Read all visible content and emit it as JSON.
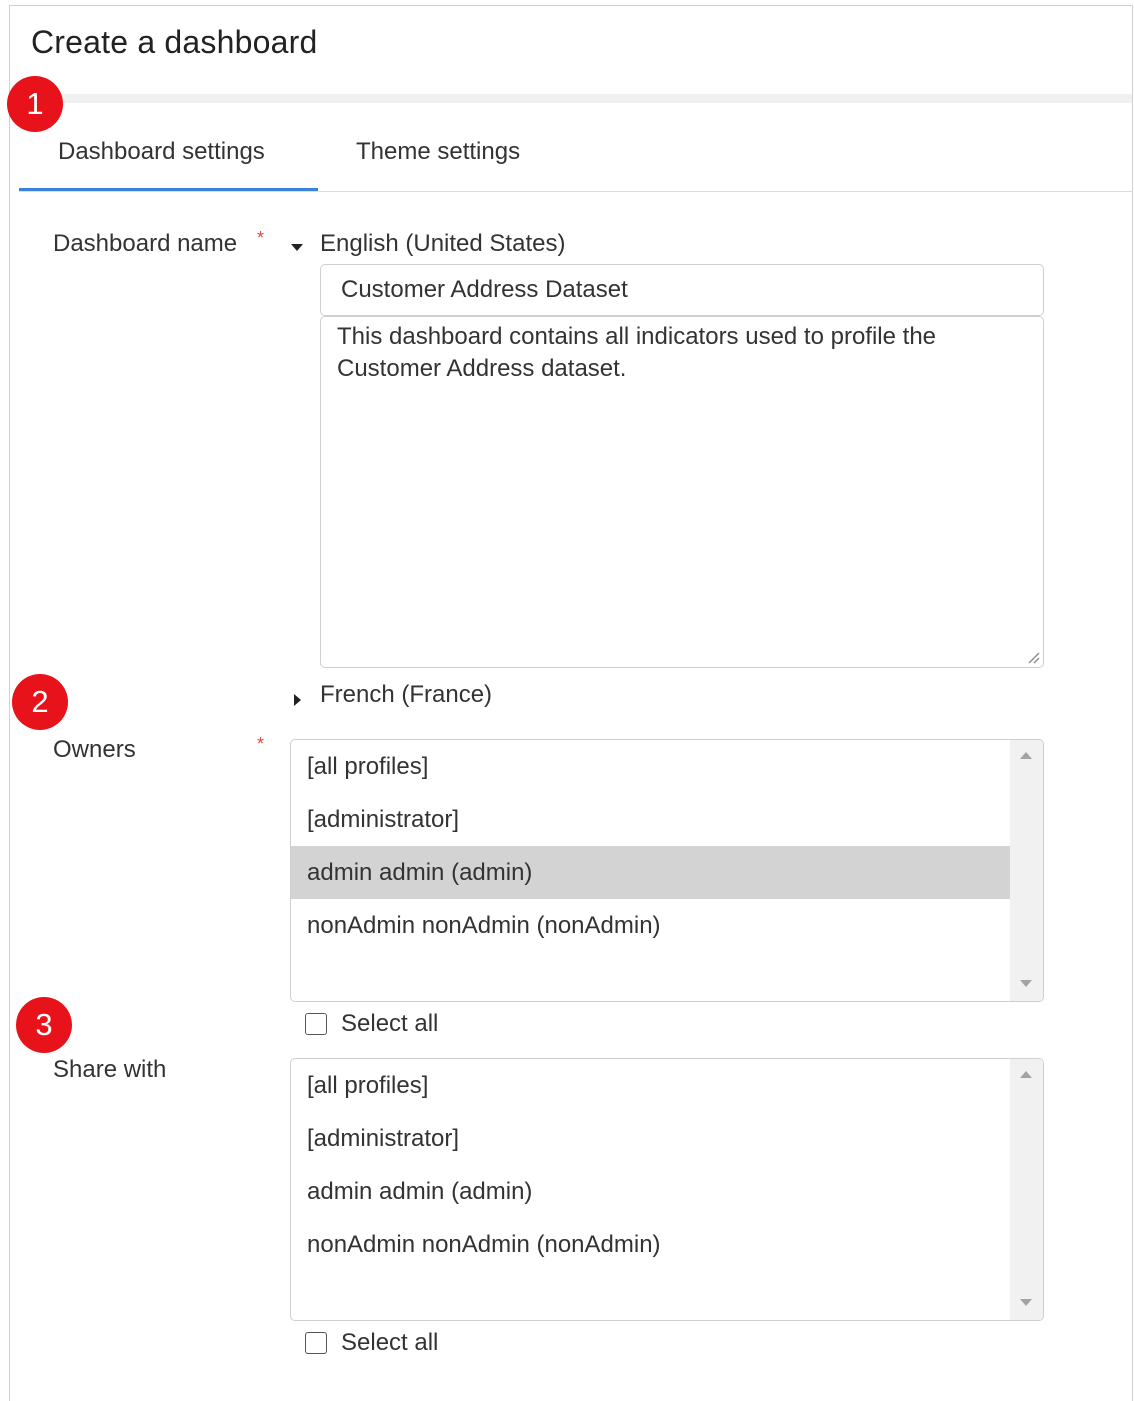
{
  "dialog": {
    "title": "Create a dashboard"
  },
  "tabs": [
    {
      "label": "Dashboard settings",
      "active": true
    },
    {
      "label": "Theme settings",
      "active": false
    }
  ],
  "badges": [
    "1",
    "2",
    "3"
  ],
  "dashboard_name": {
    "label": "Dashboard name",
    "required_marker": "*",
    "languages": [
      {
        "label": "English (United States)",
        "expanded": true
      },
      {
        "label": "French (France)",
        "expanded": false
      }
    ],
    "name_value": "Customer Address Dataset",
    "description_value": "This dashboard contains all indicators used to profile the Customer Address dataset."
  },
  "owners": {
    "label": "Owners",
    "required_marker": "*",
    "items": [
      {
        "label": "[all profiles]",
        "selected": false
      },
      {
        "label": "[administrator]",
        "selected": false
      },
      {
        "label": "admin admin (admin)",
        "selected": true
      },
      {
        "label": "nonAdmin nonAdmin (nonAdmin)",
        "selected": false
      }
    ],
    "select_all_label": "Select all"
  },
  "share_with": {
    "label": "Share with",
    "items": [
      {
        "label": "[all profiles]",
        "selected": false
      },
      {
        "label": "[administrator]",
        "selected": false
      },
      {
        "label": "admin admin (admin)",
        "selected": false
      },
      {
        "label": "nonAdmin nonAdmin (nonAdmin)",
        "selected": false
      }
    ],
    "select_all_label": "Select all"
  },
  "colors": {
    "accent": "#3b82d9",
    "badge": "#e8131a",
    "required": "#e34545",
    "selected_row": "#d3d3d3"
  }
}
